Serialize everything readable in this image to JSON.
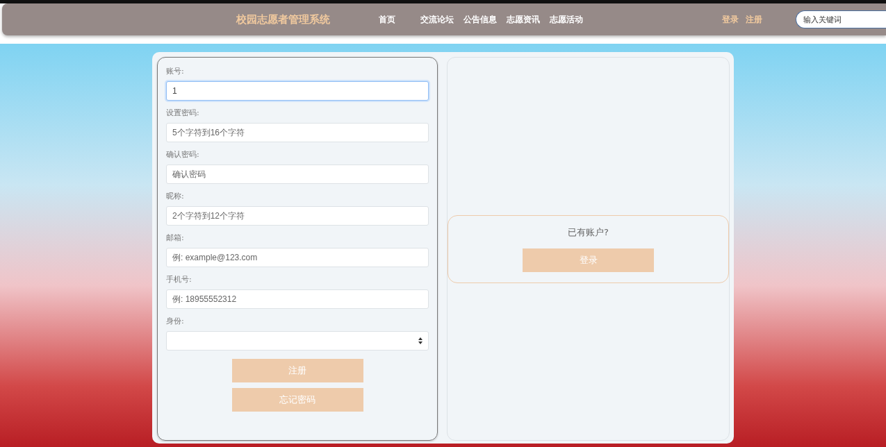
{
  "header": {
    "title": "校园志愿者管理系统",
    "nav": [
      "首页",
      "交流论坛",
      "公告信息",
      "志愿资讯",
      "志愿活动"
    ],
    "auth_links": [
      "登录",
      "注册"
    ],
    "search": {
      "placeholder": "输入关键词"
    }
  },
  "register_form": {
    "fields": [
      {
        "kind": "input",
        "label": "账号:",
        "value": "1",
        "focused": true
      },
      {
        "kind": "input",
        "label": "设置密码:",
        "placeholder": "5个字符到16个字符",
        "focused": false
      },
      {
        "kind": "input",
        "label": "确认密码:",
        "placeholder": "确认密码",
        "focused": false
      },
      {
        "kind": "input",
        "label": "昵称:",
        "placeholder": "2个字符到12个字符",
        "focused": false
      },
      {
        "kind": "input",
        "label": "邮箱:",
        "placeholder": "例: example@123.com",
        "focused": false
      },
      {
        "kind": "input",
        "label": "手机号:",
        "placeholder": "例: 18955552312",
        "focused": false
      },
      {
        "kind": "select",
        "label": "身份:",
        "focused": false
      }
    ],
    "buttons": [
      "注册",
      "忘记密码"
    ]
  },
  "login_prompt": {
    "text": "已有账户?",
    "button": "登录"
  }
}
